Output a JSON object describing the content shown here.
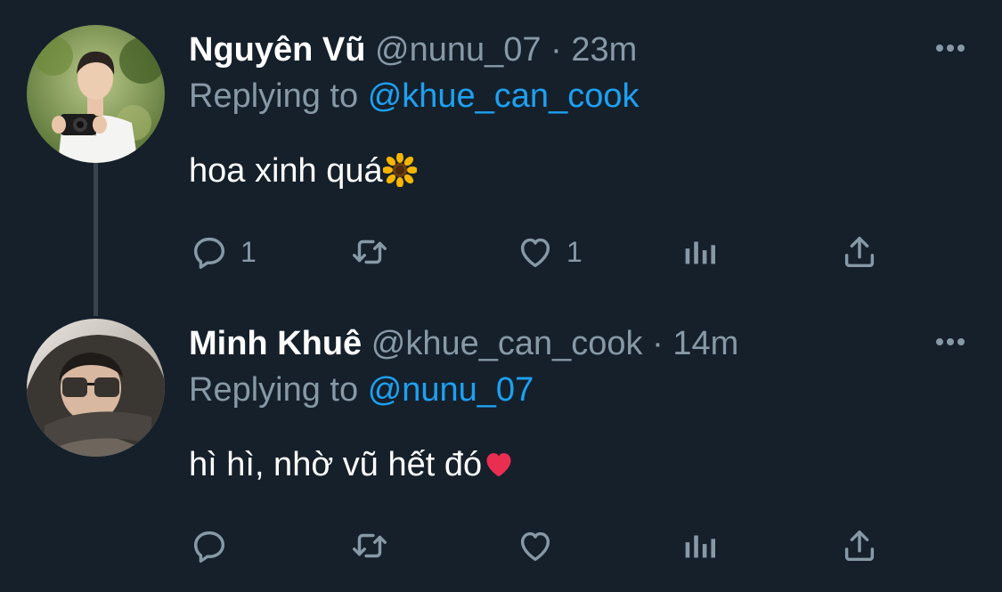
{
  "tweets": [
    {
      "display_name": "Nguyên Vũ",
      "handle": "@nunu_07",
      "separator": "·",
      "time": "23m",
      "replying_prefix": "Replying to",
      "replying_to": "@khue_can_cook",
      "text": "hoa xinh quá",
      "emoji_icon": "sunflower-emoji",
      "reply_count": "1",
      "retweet_count": "",
      "like_count": "1"
    },
    {
      "display_name": "Minh Khuê",
      "handle": "@khue_can_cook",
      "separator": "·",
      "time": "14m",
      "replying_prefix": "Replying to",
      "replying_to": "@nunu_07",
      "text": "hì hì, nhờ vũ hết đó",
      "emoji_icon": "red-heart-emoji",
      "reply_count": "",
      "retweet_count": "",
      "like_count": ""
    }
  ],
  "colors": {
    "background": "#15202b",
    "muted": "#8899a6",
    "link": "#1da1f2",
    "thread_line": "#38444d"
  }
}
